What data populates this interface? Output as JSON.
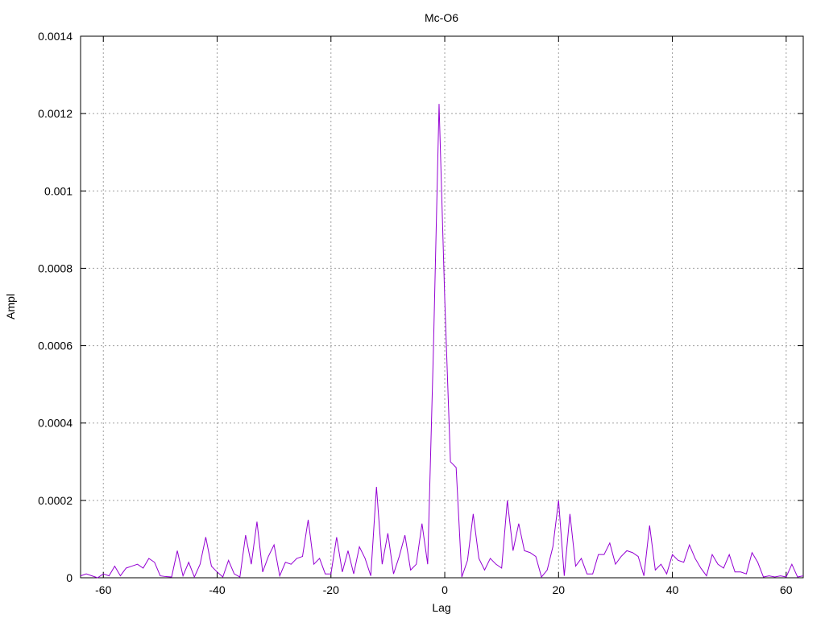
{
  "chart_data": {
    "type": "line",
    "title": "Mc-O6",
    "xlabel": "Lag",
    "ylabel": "Ampl",
    "xlim": [
      -64,
      63
    ],
    "ylim": [
      0,
      0.0014
    ],
    "grid": true,
    "line_color": "#9400d3",
    "xticks": [
      -60,
      -40,
      -20,
      0,
      20,
      40,
      60
    ],
    "xtick_labels": [
      "-60",
      "-40",
      "-20",
      "0",
      "20",
      "40",
      "60"
    ],
    "yticks": [
      0,
      0.0002,
      0.0004,
      0.0006,
      0.0008,
      0.001,
      0.0012,
      0.0014
    ],
    "ytick_labels": [
      "0",
      "0.0002",
      "0.0004",
      "0.0006",
      "0.0008",
      "0.001",
      "0.0012",
      "0.0014"
    ],
    "series": [
      {
        "x": [
          -64,
          -63,
          -62,
          -61,
          -60,
          -59,
          -58,
          -57,
          -56,
          -55,
          -54,
          -53,
          -52,
          -51,
          -50,
          -49,
          -48,
          -47,
          -46,
          -45,
          -44,
          -43,
          -42,
          -41,
          -40,
          -39,
          -38,
          -37,
          -36,
          -35,
          -34,
          -33,
          -32,
          -31,
          -30,
          -29,
          -28,
          -27,
          -26,
          -25,
          -24,
          -23,
          -22,
          -21,
          -20,
          -19,
          -18,
          -17,
          -16,
          -15,
          -14,
          -13,
          -12,
          -11,
          -10,
          -9,
          -8,
          -7,
          -6,
          -5,
          -4,
          -3,
          -2,
          -1,
          0,
          1,
          2,
          3,
          4,
          5,
          6,
          7,
          8,
          9,
          10,
          11,
          12,
          13,
          14,
          15,
          16,
          17,
          18,
          19,
          20,
          21,
          22,
          23,
          24,
          25,
          26,
          27,
          28,
          29,
          30,
          31,
          32,
          33,
          34,
          35,
          36,
          37,
          38,
          39,
          40,
          41,
          42,
          43,
          44,
          45,
          46,
          47,
          48,
          49,
          50,
          51,
          52,
          53,
          54,
          55,
          56,
          57,
          58,
          59,
          60,
          61,
          62,
          63
        ],
        "values": [
          5e-06,
          1e-05,
          5e-06,
          0.0,
          1e-05,
          5e-06,
          3e-05,
          5e-06,
          2.5e-05,
          3e-05,
          3.5e-05,
          2.5e-05,
          5e-05,
          4e-05,
          5e-06,
          3e-06,
          2e-06,
          7e-05,
          5e-06,
          4e-05,
          2e-06,
          3.5e-05,
          0.000105,
          3e-05,
          1.5e-05,
          2e-06,
          4.5e-05,
          1e-05,
          2e-06,
          0.00011,
          3.5e-05,
          0.000145,
          1.5e-05,
          5.5e-05,
          8.5e-05,
          5e-06,
          4e-05,
          3.5e-05,
          5e-05,
          5.5e-05,
          0.00015,
          3.5e-05,
          5e-05,
          1e-05,
          1e-05,
          0.000105,
          1.5e-05,
          7e-05,
          1e-05,
          8e-05,
          5e-05,
          5e-06,
          0.000235,
          3.5e-05,
          0.000115,
          1e-05,
          5.5e-05,
          0.00011,
          2e-05,
          3.5e-05,
          0.00014,
          3.5e-05,
          0.000585,
          0.001225,
          0.00072,
          0.0003,
          0.000285,
          2e-06,
          4.5e-05,
          0.000165,
          5e-05,
          2e-05,
          5e-05,
          3.5e-05,
          2.5e-05,
          0.0002,
          7e-05,
          0.00014,
          7e-05,
          6.5e-05,
          5.5e-05,
          2e-06,
          2e-05,
          8e-05,
          0.0002,
          5e-06,
          0.000165,
          3e-05,
          5e-05,
          1e-05,
          1e-05,
          6e-05,
          6e-05,
          9e-05,
          3.5e-05,
          5.5e-05,
          7e-05,
          6.5e-05,
          5.5e-05,
          5e-06,
          0.000135,
          2e-05,
          3.5e-05,
          1e-05,
          6e-05,
          4.5e-05,
          4e-05,
          8.5e-05,
          5e-05,
          2.5e-05,
          5e-06,
          6e-05,
          3.5e-05,
          2.5e-05,
          6e-05,
          1.5e-05,
          1.5e-05,
          1e-05,
          6.5e-05,
          4e-05,
          2e-06,
          5e-06,
          2e-06,
          5e-06,
          2e-06,
          3.5e-05,
          2e-06,
          5e-06
        ]
      }
    ]
  }
}
